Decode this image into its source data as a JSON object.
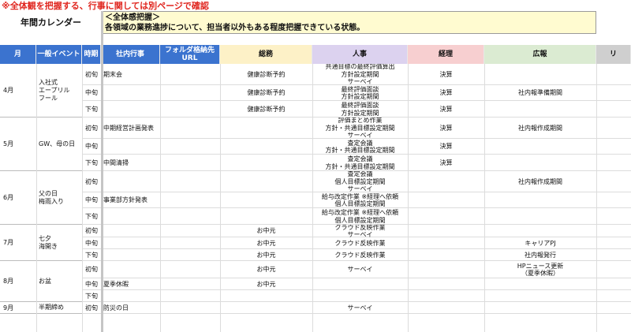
{
  "note": "※全体観を把握する、行事に関しては別ページで確認",
  "calendar_title": "年間カレンダー",
  "summary": {
    "line1": "＜全体感把握＞",
    "line2": "各領域の業務進捗について、担当者以外もある程度把握できている状態。"
  },
  "columns": [
    {
      "label": "月",
      "bg": "#3b73cf",
      "fg": "#ffffff"
    },
    {
      "label": "一般イベント",
      "bg": "#3b73cf",
      "fg": "#ffffff"
    },
    {
      "label": "時期",
      "bg": "#3b73cf",
      "fg": "#ffffff"
    },
    {
      "label": "社内行事",
      "bg": "#3b73cf",
      "fg": "#ffffff"
    },
    {
      "label": "フォルダ格納先\nURL",
      "bg": "#3b73cf",
      "fg": "#ffffff"
    },
    {
      "label": "総務",
      "bg": "#fdf1c7",
      "fg": "#111111"
    },
    {
      "label": "人事",
      "bg": "#dcd2ef",
      "fg": "#111111"
    },
    {
      "label": "経理",
      "bg": "#f7cfd0",
      "fg": "#111111"
    },
    {
      "label": "広報",
      "bg": "#dbebd2",
      "fg": "#111111"
    },
    {
      "label": "リ",
      "bg": "#cfcfcf",
      "fg": "#111111"
    }
  ],
  "months": [
    {
      "month": "4月",
      "event": "入社式\nエープリル\nフール",
      "rows": [
        {
          "period": "初旬",
          "shanai": "期末会",
          "soumu": "健康診断予約",
          "jinji": "共通目標の最終評価算出\n方針設定期間\nサーベイ",
          "keiri": "決算",
          "kouhou": ""
        },
        {
          "period": "中旬",
          "shanai": "",
          "soumu": "健康診断予約",
          "jinji": "最終評価面談\n方針設定期間",
          "keiri": "決算",
          "kouhou": "社内報準備期間"
        },
        {
          "period": "下旬",
          "shanai": "",
          "soumu": "健康診断予約",
          "jinji": "最終評価面談\n方針設定期間",
          "keiri": "決算",
          "kouhou": ""
        }
      ]
    },
    {
      "month": "5月",
      "event": "GW、母の日",
      "rows": [
        {
          "period": "初旬",
          "shanai": "中期経営計画発表",
          "soumu": "",
          "jinji": "評価まとめ作業\n方針・共通目標設定期間\nサーベイ",
          "keiri": "決算",
          "kouhou": "社内報作成期間"
        },
        {
          "period": "中旬",
          "shanai": "",
          "soumu": "",
          "jinji": "査定会議\n方針・共通目標設定期間",
          "keiri": "決算",
          "kouhou": ""
        },
        {
          "period": "下旬",
          "shanai": "中間清掃",
          "soumu": "",
          "jinji": "査定会議\n方針・共通目標設定期間",
          "keiri": "決算",
          "kouhou": ""
        }
      ]
    },
    {
      "month": "6月",
      "event": "父の日\n梅雨入り",
      "rows": [
        {
          "period": "初旬",
          "shanai": "",
          "soumu": "",
          "jinji": "査定会議\n個人目標設定期間\nサーベイ",
          "keiri": "",
          "kouhou": "社内報作成期間"
        },
        {
          "period": "中旬",
          "shanai": "事業部方針発表",
          "soumu": "",
          "jinji": "給与改定作業 ※経理へ依頼\n個人目標設定期間",
          "keiri": "",
          "kouhou": ""
        },
        {
          "period": "下旬",
          "shanai": "",
          "soumu": "",
          "jinji": "給与改定作業 ※経理へ依頼\n個人目標設定期間",
          "keiri": "",
          "kouhou": ""
        }
      ]
    },
    {
      "month": "7月",
      "event": "七夕\n海開き",
      "rows": [
        {
          "period": "初旬",
          "shanai": "",
          "soumu": "お中元",
          "jinji": "クラウド反映作業\nサーベイ",
          "keiri": "",
          "kouhou": ""
        },
        {
          "period": "中旬",
          "shanai": "",
          "soumu": "お中元",
          "jinji": "クラウド反映作業",
          "keiri": "",
          "kouhou": "キャリアPJ"
        },
        {
          "period": "下旬",
          "shanai": "",
          "soumu": "お中元",
          "jinji": "クラウド反映作業",
          "keiri": "",
          "kouhou": "社内報発行"
        }
      ]
    },
    {
      "month": "8月",
      "event": "お盆",
      "rows": [
        {
          "period": "初旬",
          "shanai": "",
          "soumu": "お中元",
          "jinji": "サーベイ",
          "keiri": "",
          "kouhou": "HPニュース更新\n（夏季休暇）"
        },
        {
          "period": "中旬",
          "shanai": "夏季休暇",
          "soumu": "お中元",
          "jinji": "",
          "keiri": "",
          "kouhou": ""
        },
        {
          "period": "下旬",
          "shanai": "",
          "soumu": "",
          "jinji": "",
          "keiri": "",
          "kouhou": ""
        }
      ]
    },
    {
      "month": "9月",
      "event": "半期締め",
      "rows": [
        {
          "period": "初旬",
          "shanai": "防災の日",
          "soumu": "",
          "jinji": "サーベイ",
          "keiri": "",
          "kouhou": ""
        }
      ]
    }
  ]
}
